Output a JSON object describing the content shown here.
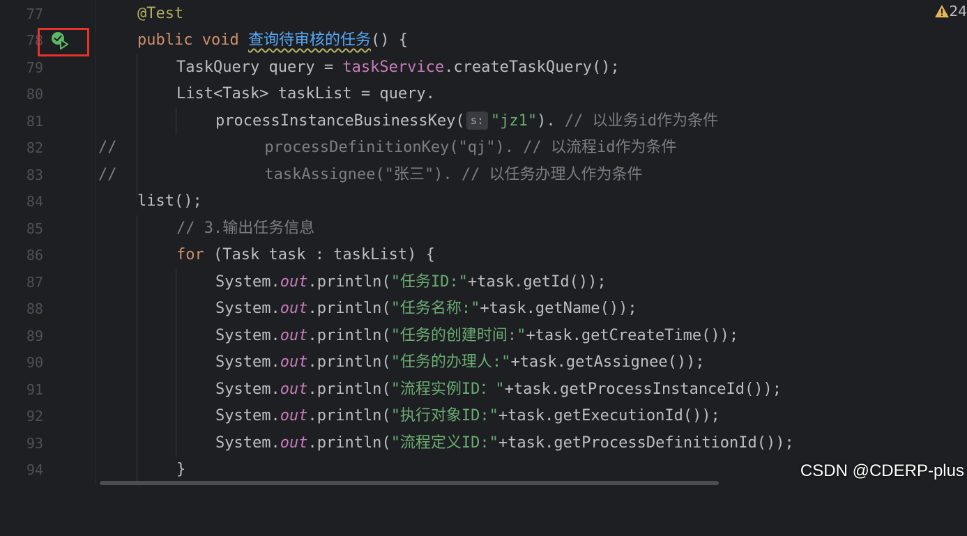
{
  "editor": {
    "line_numbers": [
      "77",
      "78",
      "79",
      "80",
      "81",
      "82",
      "83",
      "84",
      "85",
      "86",
      "87",
      "88",
      "89",
      "90",
      "91",
      "92",
      "93",
      "94"
    ],
    "warning_count": "24",
    "param_hint": "s:",
    "watermark": "CSDN @CDERP-plus",
    "tokens": {
      "l77_ann": "@Test",
      "l78_public": "public",
      "l78_void": "void",
      "l78_name": "查询待审核的任务",
      "l78_rest": "() {",
      "l79_a": "TaskQuery query = ",
      "l79_field": "taskService",
      "l79_b": ".createTaskQuery();",
      "l80": "List<Task> taskList = query.",
      "l81_a": "processInstanceBusinessKey(",
      "l81_str": "\"jz1\"",
      "l81_b": "). ",
      "l81_cmt": "// 以业务id作为条件",
      "l82": "//                processDefinitionKey(\"qj\"). // 以流程id作为条件",
      "l83": "//                taskAssignee(\"张三\"). // 以任务办理人作为条件",
      "l84": "list();",
      "l85_cmt": "// 3.输出任务信息",
      "l86_for": "for",
      "l86_rest": " (Task task : taskList) {",
      "sys": "System.",
      "out": "out",
      "println": ".println(",
      "l87_str": "\"任务ID:\"",
      "l87_rest": "+task.getId());",
      "l88_str": "\"任务名称:\"",
      "l88_rest": "+task.getName());",
      "l89_str": "\"任务的创建时间:\"",
      "l89_rest": "+task.getCreateTime());",
      "l90_str": "\"任务的办理人:\"",
      "l90_rest": "+task.getAssignee());",
      "l91_str": "\"流程实例ID：\"",
      "l91_rest": "+task.getProcessInstanceId());",
      "l92_str": "\"执行对象ID:\"",
      "l92_rest": "+task.getExecutionId());",
      "l93_str": "\"流程定义ID:\"",
      "l93_rest": "+task.getProcessDefinitionId());",
      "l94": "}"
    }
  },
  "colors": {
    "background": "#1e1f22",
    "keyword": "#cf8e6d",
    "annotation": "#b3ae60",
    "method_decl": "#56a8f5",
    "field": "#c77dbb",
    "string": "#6aab73",
    "comment": "#7a7e85",
    "highlight_box": "#e8322c"
  },
  "icons": {
    "run_test": "run-test-passed-icon",
    "warning": "warning-triangle-icon"
  }
}
